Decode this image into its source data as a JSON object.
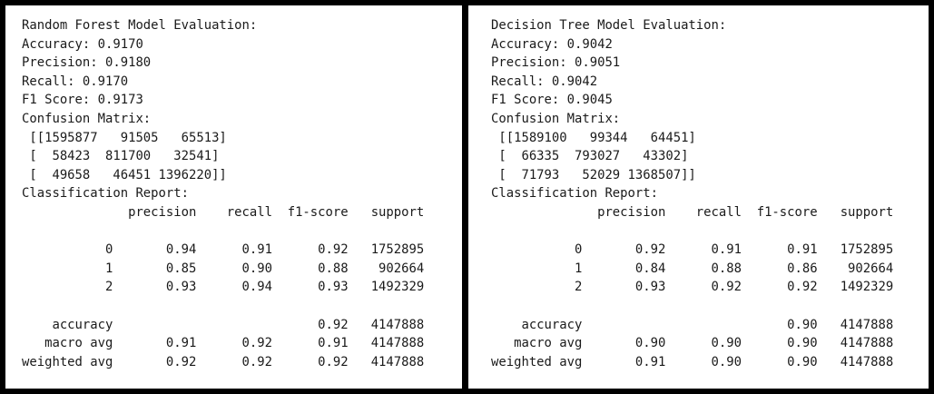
{
  "panels": [
    {
      "lines": [
        "Random Forest Model Evaluation:",
        "Accuracy: 0.9170",
        "Precision: 0.9180",
        "Recall: 0.9170",
        "F1 Score: 0.9173",
        "Confusion Matrix:",
        " [[1595877   91505   65513]",
        " [  58423  811700   32541]",
        " [  49658   46451 1396220]]",
        "Classification Report:",
        "              precision    recall  f1-score   support",
        "",
        "           0       0.94      0.91      0.92   1752895",
        "           1       0.85      0.90      0.88    902664",
        "           2       0.93      0.94      0.93   1492329",
        "",
        "    accuracy                           0.92   4147888",
        "   macro avg       0.91      0.92      0.91   4147888",
        "weighted avg       0.92      0.92      0.92   4147888"
      ]
    },
    {
      "lines": [
        "Decision Tree Model Evaluation:",
        "Accuracy: 0.9042",
        "Precision: 0.9051",
        "Recall: 0.9042",
        "F1 Score: 0.9045",
        "Confusion Matrix:",
        " [[1589100   99344   64451]",
        " [  66335  793027   43302]",
        " [  71793   52029 1368507]]",
        "Classification Report:",
        "              precision    recall  f1-score   support",
        "",
        "           0       0.92      0.91      0.91   1752895",
        "           1       0.84      0.88      0.86    902664",
        "           2       0.93      0.92      0.92   1492329",
        "",
        "    accuracy                           0.90   4147888",
        "   macro avg       0.90      0.90      0.90   4147888",
        "weighted avg       0.91      0.90      0.90   4147888"
      ]
    }
  ]
}
